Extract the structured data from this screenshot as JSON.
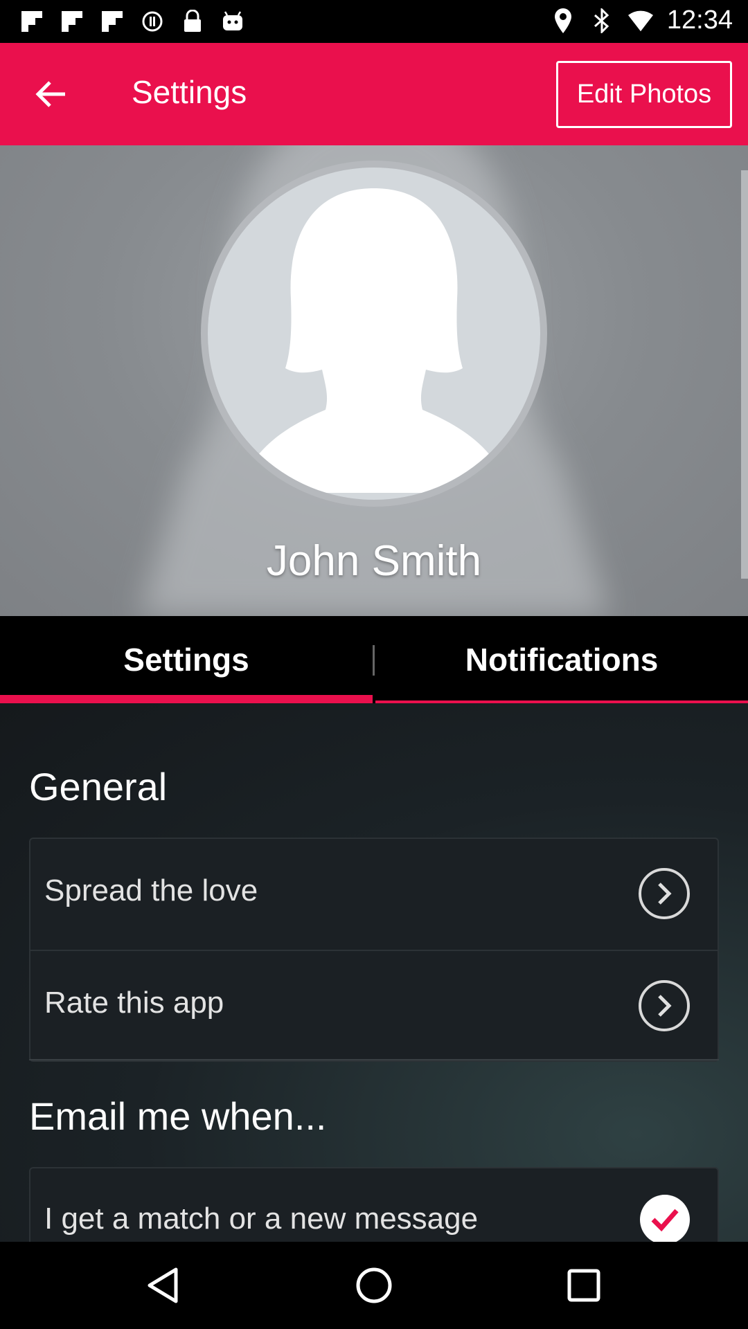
{
  "status_bar": {
    "time": "12:34",
    "left_icons": [
      "flipboard-icon",
      "flipboard-icon",
      "flipboard-icon",
      "sync-icon",
      "lock-icon",
      "android-icon"
    ],
    "right_icons": [
      "location-icon",
      "bluetooth-icon",
      "wifi-icon"
    ]
  },
  "app_bar": {
    "title": "Settings",
    "edit_photos_label": "Edit Photos",
    "background_color": "#ea104d"
  },
  "profile": {
    "name": "John Smith"
  },
  "tabs": [
    {
      "label": "Settings",
      "active": true
    },
    {
      "label": "Notifications",
      "active": false
    }
  ],
  "general": {
    "title": "General",
    "items": [
      {
        "label": "Spread the love"
      },
      {
        "label": "Rate this app"
      }
    ]
  },
  "email": {
    "title": "Email me when...",
    "items": [
      {
        "label": "I get a match or a new message",
        "checked": true
      }
    ]
  },
  "accent_color": "#ea104d"
}
